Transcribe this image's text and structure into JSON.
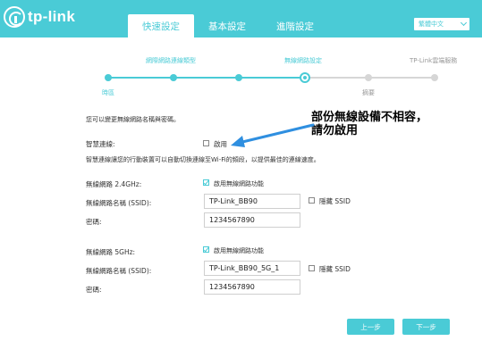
{
  "header": {
    "logo_text": "tp-link",
    "tabs": [
      {
        "label": "快速設定",
        "active": true
      },
      {
        "label": "基本設定",
        "active": false
      },
      {
        "label": "進階設定",
        "active": false
      }
    ],
    "language": "繁體中文",
    "accent_color": "#4acbd6"
  },
  "progress": {
    "steps_top": [
      "網際網路連線類型",
      "無線網路設定",
      "TP-Link雲端服務"
    ],
    "steps_bottom": [
      "時區",
      "摘要"
    ]
  },
  "form": {
    "intro": "您可以變更無線網路名稱與密碼。",
    "smart_connect_label": "智慧連線:",
    "smart_connect_option": "啟用",
    "smart_connect_desc": "智慧連線讓您的行動裝置可以自動切換連線至Wi-Fi的頻段，以提供最佳的連線速度。",
    "band24": {
      "label": "無線網路 2.4GHz:",
      "enable_label": "啟用無線網路功能",
      "ssid_label": "無線網路名稱 (SSID):",
      "ssid_value": "TP-Link_BB90",
      "hide_ssid_label": "隱藏 SSID",
      "password_label": "密碼:",
      "password_value": "1234567890"
    },
    "band5": {
      "label": "無線網路 5GHz:",
      "enable_label": "啟用無線網路功能",
      "ssid_label": "無線網路名稱 (SSID):",
      "ssid_value": "TP-Link_BB90_5G_1",
      "hide_ssid_label": "隱藏 SSID",
      "password_label": "密碼:",
      "password_value": "1234567890"
    }
  },
  "annotation": {
    "line1": "部份無線設備不相容，",
    "line2": "請勿啟用"
  },
  "buttons": {
    "back": "上一步",
    "next": "下一步"
  }
}
